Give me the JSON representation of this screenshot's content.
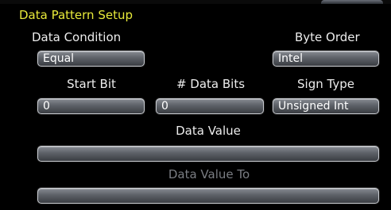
{
  "panel": {
    "title": "Data Pattern Setup"
  },
  "data_condition": {
    "label": "Data Condition",
    "value": "Equal"
  },
  "byte_order": {
    "label": "Byte Order",
    "value": "Intel"
  },
  "start_bit": {
    "label": "Start Bit",
    "value": "0"
  },
  "num_data_bits": {
    "label": "# Data Bits",
    "value": "0"
  },
  "sign_type": {
    "label": "Sign Type",
    "value": "Unsigned Int"
  },
  "data_value": {
    "label": "Data Value",
    "value": ""
  },
  "data_value_to": {
    "label": "Data Value To",
    "value": ""
  },
  "colors": {
    "title": "#e8ea3a",
    "label": "#ededed",
    "disabled_label": "#7a7d83",
    "background": "#000000"
  }
}
